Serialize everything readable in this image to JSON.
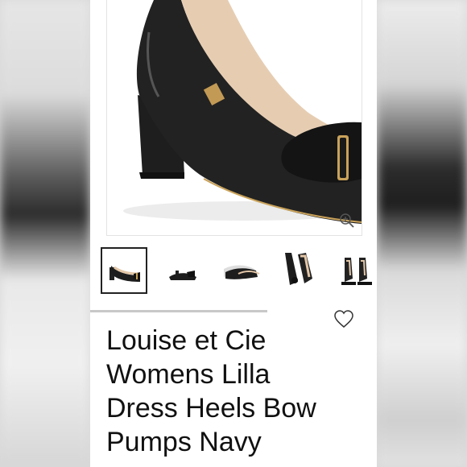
{
  "product": {
    "title_lines": [
      "Louise et Cie",
      "Womens Lilla",
      "Dress Heels Bow",
      "Pumps Navy"
    ]
  },
  "icons": {
    "zoom": "zoom-in-icon",
    "favorite": "heart-outline-icon"
  },
  "gallery": {
    "thumbnail_count": 5,
    "selected_index": 0
  },
  "colors": {
    "shoe": "#1c1c1c",
    "accent_gold": "#c9a25a",
    "lining": "#e4c9ad"
  }
}
